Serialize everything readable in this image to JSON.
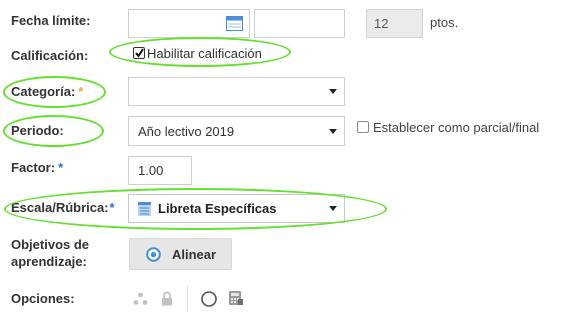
{
  "form": {
    "deadline": {
      "label": "Fecha límite:",
      "date_value": "",
      "time_value": "",
      "points_value": "12",
      "points_unit": "ptos."
    },
    "grading": {
      "label": "Calificación:",
      "checkbox_label": "Habilitar calificación",
      "checked": true
    },
    "category": {
      "label": "Categoría:",
      "required_mark": "*",
      "selected": ""
    },
    "period": {
      "label": "Periodo:",
      "selected": "Año lectivo 2019",
      "partial_checkbox_label": "Establecer como parcial/final"
    },
    "factor": {
      "label": "Factor:",
      "required_mark": "*",
      "value": "1.00"
    },
    "scale": {
      "label": "Escala/Rúbrica:",
      "required_mark": "*",
      "selected": "Libreta Específicas"
    },
    "objectives": {
      "label_line1": "Objetivos de",
      "label_line2": "aprendizaje:",
      "button_label": "Alinear"
    },
    "options": {
      "label": "Opciones:"
    }
  },
  "colors": {
    "highlight": "#66e030",
    "required_blue": "#2a6bd8",
    "required_orange": "#f0a04b",
    "calendar_icon": "#4a90d9"
  },
  "icons": [
    "calendar-icon",
    "list-icon",
    "target-icon",
    "dots-icon",
    "lock-icon",
    "circle-icon",
    "calculator-icon"
  ]
}
